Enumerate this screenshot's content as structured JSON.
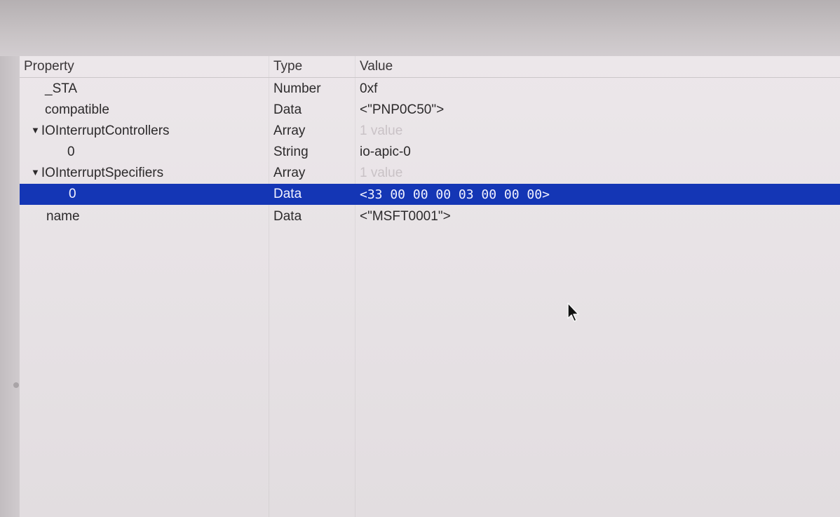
{
  "columns": {
    "property": "Property",
    "type": "Type",
    "value": "Value"
  },
  "rows": [
    {
      "property": "_STA",
      "type": "Number",
      "value": "0xf"
    },
    {
      "property": "compatible",
      "type": "Data",
      "value": "<\"PNP0C50\">"
    },
    {
      "property": "IOInterruptControllers",
      "type": "Array",
      "value": "1 value",
      "expanded": true
    },
    {
      "property": "0",
      "type": "String",
      "value": "io-apic-0"
    },
    {
      "property": "IOInterruptSpecifiers",
      "type": "Array",
      "value": "1 value",
      "expanded": true
    },
    {
      "property": "0",
      "type": "Data",
      "value": "<33 00 00 00 03 00 00 00>",
      "selected": true
    },
    {
      "property": "name",
      "type": "Data",
      "value": "<\"MSFT0001\">"
    }
  ],
  "icons": {
    "disclosure": "disclosure-triangle-down-icon",
    "pointer": "mouse-pointer-icon"
  },
  "colors": {
    "selection": "#1436b5",
    "selected_text": "#f2f2ff",
    "dim_text": "#c9c2c6"
  }
}
